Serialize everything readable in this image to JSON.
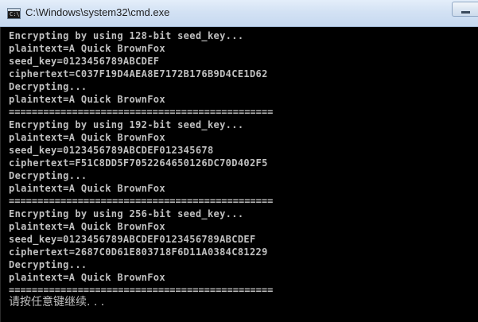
{
  "window": {
    "title": "C:\\Windows\\system32\\cmd.exe",
    "icon": "cmd-icon",
    "icon_glyph": "C:\\",
    "colors": {
      "console_bg": "#000000",
      "console_text": "#c0c0c0",
      "titlebar": "#d3e2f4"
    }
  },
  "console": {
    "lines": [
      "Encrypting by using 128-bit seed_key...",
      "plaintext=A Quick BrownFox",
      "seed_key=0123456789ABCDEF",
      "ciphertext=C037F19D4AEA8E7172B176B9D4CE1D62",
      "Decrypting...",
      "plaintext=A Quick BrownFox",
      "==============================================",
      "Encrypting by using 192-bit seed_key...",
      "plaintext=A Quick BrownFox",
      "seed_key=0123456789ABCDEF012345678",
      "ciphertext=F51C8DD5F7052264650126DC70D402F5",
      "Decrypting...",
      "plaintext=A Quick BrownFox",
      "==============================================",
      "Encrypting by using 256-bit seed_key...",
      "plaintext=A Quick BrownFox",
      "seed_key=0123456789ABCDEF0123456789ABCDEF",
      "ciphertext=2687C0D61E803718F6D11A0384C81229",
      "Decrypting...",
      "plaintext=A Quick BrownFox",
      "=============================================="
    ],
    "prompt": "请按任意键继续. . ."
  }
}
